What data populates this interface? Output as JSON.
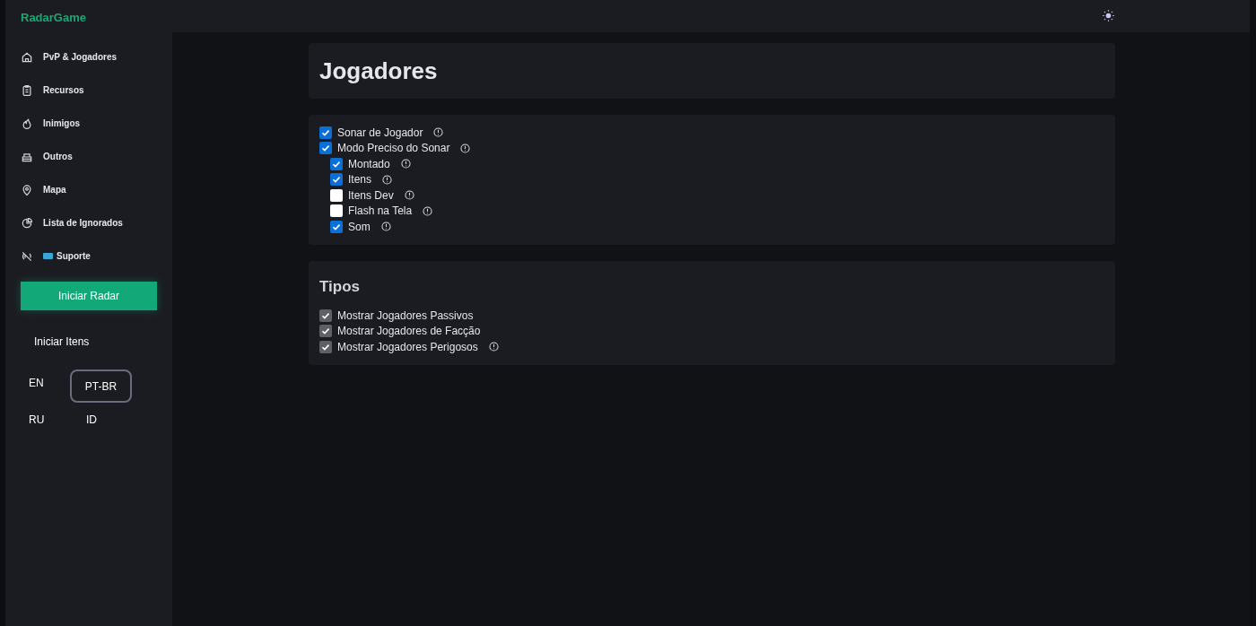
{
  "app": {
    "title": "RadarGame"
  },
  "sidebar": {
    "items": [
      {
        "label": "PvP & Jogadores"
      },
      {
        "label": "Recursos"
      },
      {
        "label": "Inimigos"
      },
      {
        "label": "Outros"
      },
      {
        "label": "Mapa"
      },
      {
        "label": "Lista de Ignorados"
      },
      {
        "label": "Suporte"
      }
    ],
    "primary_button": "Iniciar Radar",
    "secondary_button": "Iniciar Itens",
    "languages": [
      {
        "label": "EN",
        "selected": false
      },
      {
        "label": "PT-BR",
        "selected": true
      },
      {
        "label": "RU",
        "selected": false
      },
      {
        "label": "ID",
        "selected": false
      }
    ]
  },
  "page": {
    "title": "Jogadores"
  },
  "sections": [
    {
      "options": [
        {
          "label": "Sonar de Jogador",
          "checked": true,
          "disabled": false,
          "info": true
        },
        {
          "label": "Modo Preciso do Sonar",
          "checked": true,
          "disabled": false,
          "info": true,
          "children": [
            {
              "label": "Montado",
              "checked": true,
              "disabled": false,
              "info": true
            },
            {
              "label": "Itens",
              "checked": true,
              "disabled": false,
              "info": true
            },
            {
              "label": "Itens Dev",
              "checked": false,
              "disabled": false,
              "info": true
            },
            {
              "label": "Flash na Tela",
              "checked": false,
              "disabled": false,
              "info": true
            },
            {
              "label": "Som",
              "checked": true,
              "disabled": false,
              "info": true
            }
          ]
        }
      ]
    },
    {
      "title": "Tipos",
      "options": [
        {
          "label": "Mostrar Jogadores Passivos",
          "checked": true,
          "disabled": true,
          "info": false
        },
        {
          "label": "Mostrar Jogadores de Facção",
          "checked": true,
          "disabled": true,
          "info": false
        },
        {
          "label": "Mostrar Jogadores Perigosos",
          "checked": true,
          "disabled": true,
          "info": true
        }
      ]
    }
  ]
}
